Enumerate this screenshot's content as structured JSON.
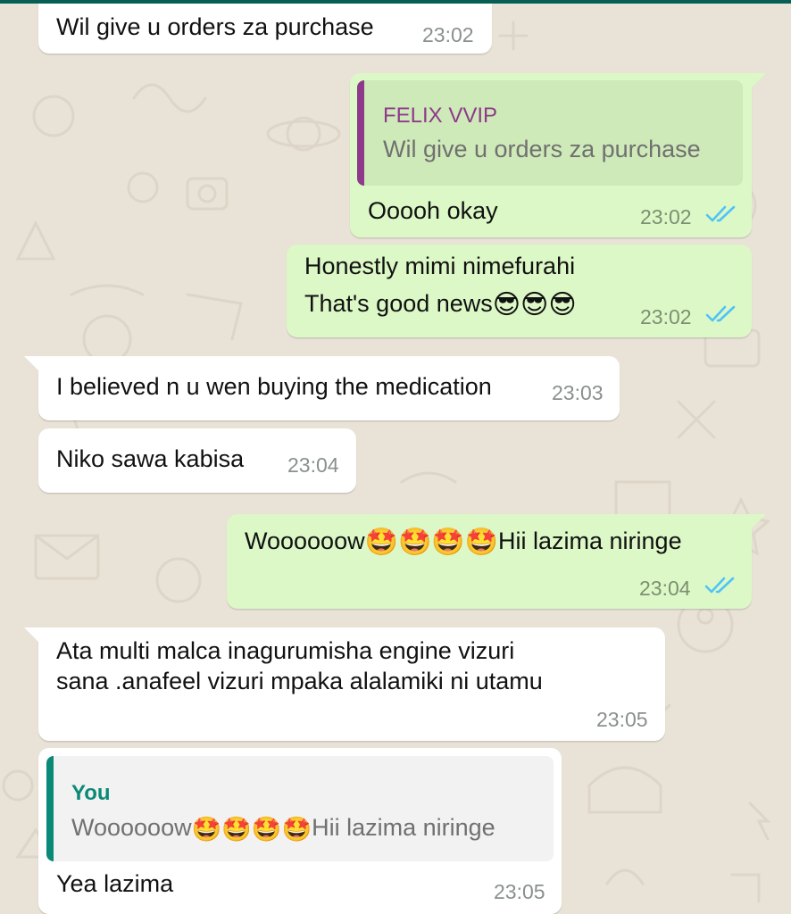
{
  "colors": {
    "incoming_bubble": "#ffffff",
    "outgoing_bubble": "#dcf8c6",
    "read_ticks": "#4fc3f7",
    "quote_name_felix": "#8e3a8a",
    "quote_name_you": "#0a8a76"
  },
  "messages": [
    {
      "direction": "in",
      "text": "Wil give u orders za purchase",
      "time": "23:02"
    },
    {
      "direction": "out",
      "quote_author": "FELIX VVIP",
      "quote_text": "Wil give u orders za purchase",
      "text": "Ooooh okay",
      "time": "23:02",
      "status": "read"
    },
    {
      "direction": "out",
      "line1": "Honestly mimi nimefurahi",
      "line2": "That's good news",
      "emojis": "😎😎😎",
      "time": "23:02",
      "status": "read"
    },
    {
      "direction": "in",
      "text": "I believed n u wen buying the medication",
      "time": "23:03"
    },
    {
      "direction": "in",
      "text": "Niko sawa kabisa",
      "time": "23:04"
    },
    {
      "direction": "out",
      "text_before": "Woooooow",
      "emojis": "🤩🤩🤩🤩",
      "text_after": "Hii lazima niringe",
      "time": "23:04",
      "status": "read"
    },
    {
      "direction": "in",
      "line1": "Ata multi malca inagurumisha engine vizuri",
      "line2": "sana .anafeel vizuri mpaka alalamiki ni utamu",
      "time": "23:05"
    },
    {
      "direction": "in",
      "quote_author": "You",
      "quote_text_before": "Woooooow",
      "quote_emojis": "🤩🤩🤩🤩",
      "quote_text_after": "Hii lazima niringe",
      "text": "Yea lazima",
      "time": "23:05"
    }
  ]
}
